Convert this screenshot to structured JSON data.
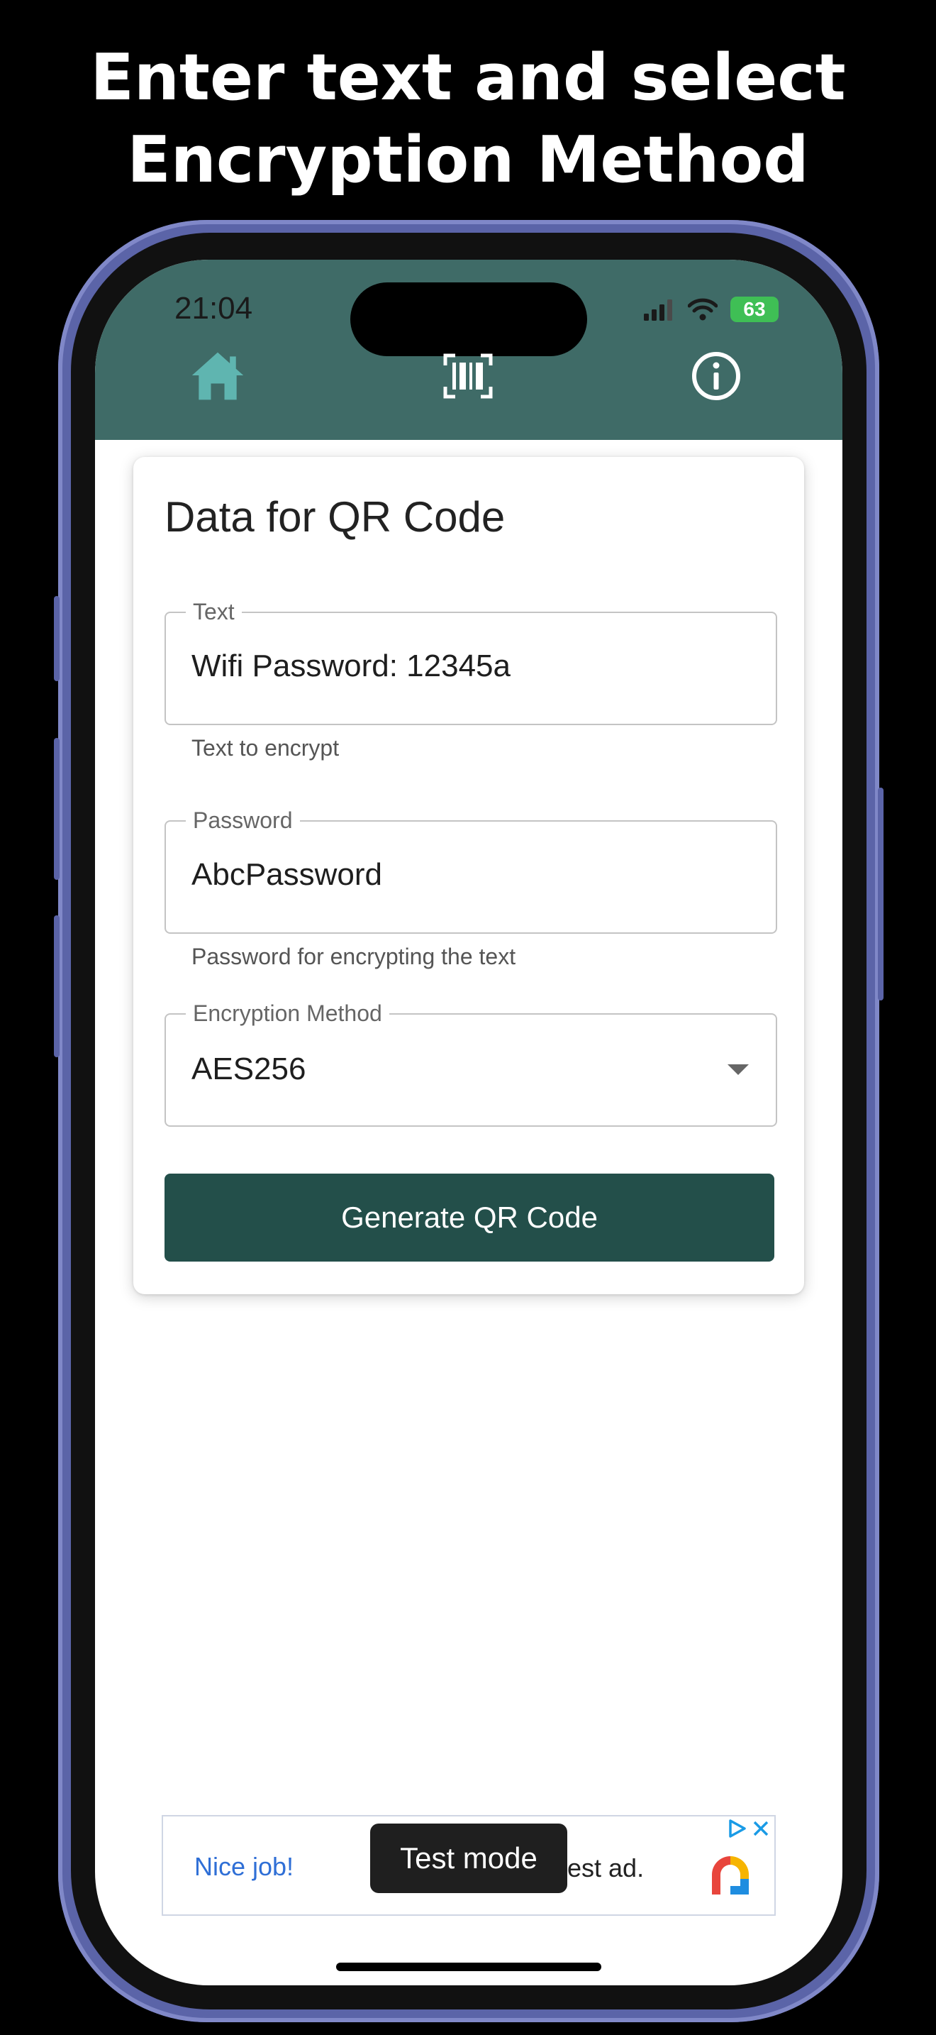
{
  "headline": {
    "line1": "Enter text and select",
    "line2": "Encryption Method"
  },
  "status_bar": {
    "time": "21:04",
    "battery": "63"
  },
  "nav": {
    "home_icon": "home-icon",
    "scan_icon": "barcode-scan-icon",
    "info_icon": "info-icon"
  },
  "colors": {
    "header": "#3f6b67",
    "button": "#234f4a",
    "home_icon": "#5fb5b0"
  },
  "card": {
    "title": "Data for QR Code",
    "text_field": {
      "label": "Text",
      "value": "Wifi Password: 12345a",
      "helper": "Text to encrypt"
    },
    "password_field": {
      "label": "Password",
      "value": "AbcPassword",
      "helper": "Password for encrypting the text"
    },
    "method_field": {
      "label": "Encryption Method",
      "value": "AES256"
    },
    "generate_label": "Generate QR Code"
  },
  "ad": {
    "left_text": "Nice job!",
    "right_text": "est ad.",
    "toast": "Test mode"
  }
}
